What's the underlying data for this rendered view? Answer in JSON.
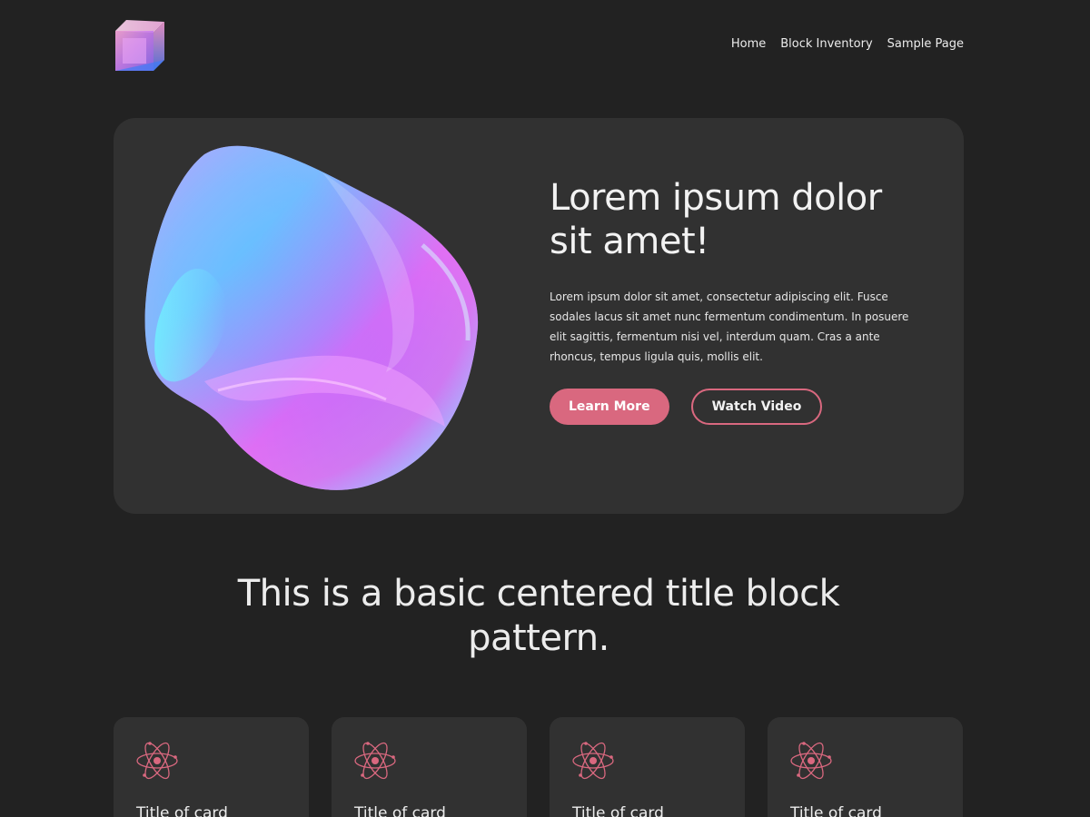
{
  "header": {
    "nav": [
      "Home",
      "Block Inventory",
      "Sample Page"
    ]
  },
  "hero": {
    "title": "Lorem ipsum dolor sit amet!",
    "body": "Lorem ipsum dolor sit amet, consectetur adipiscing elit. Fusce sodales lacus sit amet nunc fermentum condimentum. In posuere elit sagittis, fermentum nisi vel, interdum quam. Cras a ante rhoncus, tempus ligula quis, mollis elit.",
    "primary_button": "Learn More",
    "secondary_button": "Watch Video"
  },
  "section": {
    "title": "This is a basic centered title block pattern."
  },
  "cards": [
    {
      "icon": "atom-icon",
      "title": "Title of card"
    },
    {
      "icon": "atom-icon",
      "title": "Title of card"
    },
    {
      "icon": "atom-icon",
      "title": "Title of card"
    },
    {
      "icon": "atom-icon",
      "title": "Title of card"
    }
  ],
  "colors": {
    "background": "#222222",
    "surface": "#313131",
    "accent": "#d9687f",
    "text": "#ececec"
  }
}
